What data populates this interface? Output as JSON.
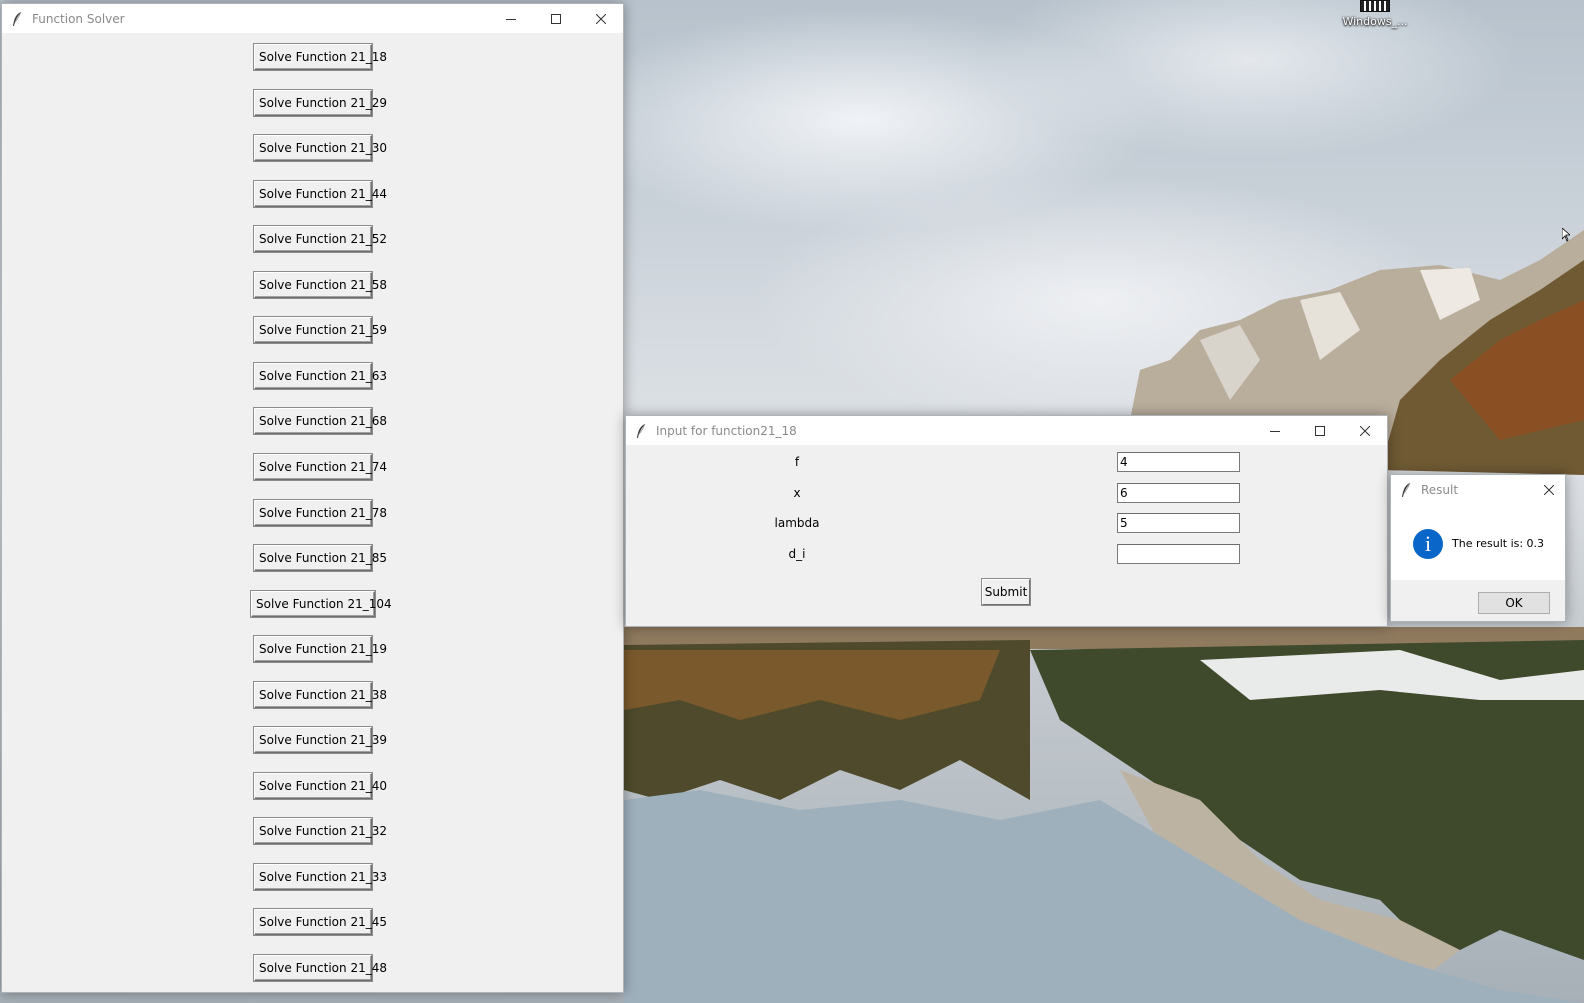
{
  "desktop": {
    "icons": [
      {
        "label": "Windows_..."
      }
    ]
  },
  "main_window": {
    "title": "Function Solver",
    "buttons": [
      "Solve Function 21_18",
      "Solve Function 21_29",
      "Solve Function 21_30",
      "Solve Function 21_44",
      "Solve Function 21_52",
      "Solve Function 21_58",
      "Solve Function 21_59",
      "Solve Function 21_63",
      "Solve Function 21_68",
      "Solve Function 21_74",
      "Solve Function 21_78",
      "Solve Function 21_85",
      "Solve Function 21_104",
      "Solve Function 21_19",
      "Solve Function 21_38",
      "Solve Function 21_39",
      "Solve Function 21_40",
      "Solve Function 21_32",
      "Solve Function 21_33",
      "Solve Function 21_45",
      "Solve Function 21_48"
    ]
  },
  "input_window": {
    "title": "Input for function21_18",
    "fields": [
      {
        "label": "f",
        "value": "4"
      },
      {
        "label": "x",
        "value": "6"
      },
      {
        "label": "lambda",
        "value": "5"
      },
      {
        "label": "d_i",
        "value": ""
      }
    ],
    "submit_label": "Submit"
  },
  "result_dialog": {
    "title": "Result",
    "icon": "info-icon",
    "message": "The result is: 0.3",
    "ok_label": "OK"
  },
  "colors": {
    "window_bg": "#f0f0f0",
    "titlebar_bg": "#ffffff",
    "title_text": "#8a8a8a",
    "info_icon": "#0a66c8"
  }
}
